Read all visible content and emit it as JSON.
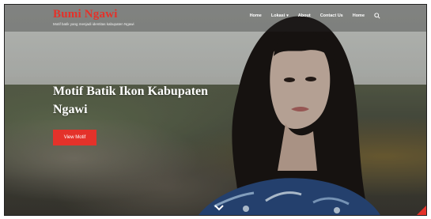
{
  "header": {
    "brand": "Bumi Ngawi",
    "tagline": "Motif batik yang menjadi identitas kabupaten Ngawi",
    "nav": [
      {
        "label": "Home"
      },
      {
        "label": "Lokasi",
        "has_dropdown": true
      },
      {
        "label": "About"
      },
      {
        "label": "Contact Us"
      },
      {
        "label": "Home"
      }
    ],
    "search_icon": "search-icon"
  },
  "hero": {
    "headline": "Motif Batik Ikon Kabupaten Ngawi",
    "cta_label": "View Motif",
    "scroll_icon": "chevron-down-icon"
  },
  "colors": {
    "accent": "#e4322a",
    "nav_text": "#ffffff"
  }
}
